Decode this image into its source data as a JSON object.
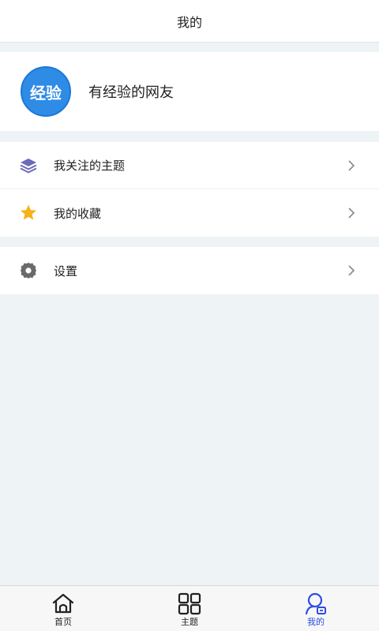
{
  "header": {
    "title": "我的"
  },
  "profile": {
    "avatar_text": "经验",
    "username": "有经验的网友"
  },
  "menu": {
    "group1": [
      {
        "label": "我关注的主题",
        "icon": "layers-icon"
      },
      {
        "label": "我的收藏",
        "icon": "star-icon"
      }
    ],
    "group2": [
      {
        "label": "设置",
        "icon": "gear-icon"
      }
    ]
  },
  "tabbar": {
    "tabs": [
      {
        "label": "首页",
        "icon": "home-icon",
        "active": false
      },
      {
        "label": "主题",
        "icon": "grid-icon",
        "active": false
      },
      {
        "label": "我的",
        "icon": "user-icon",
        "active": true
      }
    ]
  },
  "colors": {
    "accent": "#2d4de0",
    "avatar_bg": "#2e8be6",
    "star": "#f6b21a",
    "layers": "#5a5aa8",
    "gear": "#666666",
    "page_bg": "#eef3f5"
  }
}
